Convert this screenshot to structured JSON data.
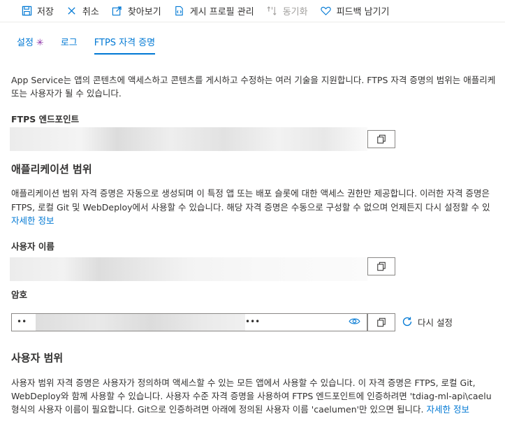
{
  "toolbar": {
    "save": "저장",
    "cancel": "취소",
    "browse": "찾아보기",
    "manage_profile": "게시 프로필 관리",
    "sync": "동기화",
    "feedback": "피드백 남기기"
  },
  "tabs": {
    "settings": "설정",
    "settings_star": "✳",
    "logs": "로그",
    "ftps": "FTPS 자격 증명"
  },
  "intro": {
    "line1": "App Service는 앱의 콘텐츠에 액세스하고 콘텐츠를 게시하고 수정하는 여러 기술을 지원합니다. FTPS 자격 증명의 범위는 애플리케",
    "line2": "또는 사용자가 될 수 있습니다."
  },
  "ftps_endpoint": {
    "label": "FTPS 엔드포인트"
  },
  "app_scope": {
    "title": "애플리케이션 범위",
    "line1": "애플리케이션 범위 자격 증명은 자동으로 생성되며 이 특정 앱 또는 배포 슬롯에 대한 액세스 권한만 제공합니다. 이러한 자격 증명은",
    "line2": "FTPS, 로컬 Git 및 WebDeploy에서 사용할 수 있습니다. 해당 자격 증명은 수동으로 구성할 수 없으며 언제든지 다시 설정할 수 있",
    "link": "자세한 정보"
  },
  "username": {
    "label": "사용자 이름"
  },
  "password": {
    "label": "암호",
    "dots_start": "••",
    "dots_end": "•••",
    "reset": "다시 설정"
  },
  "user_scope": {
    "title": "사용자 범위",
    "line1": "사용자 범위 자격 증명은 사용자가 정의하며 액세스할 수 있는 모든 앱에서 사용할 수 있습니다. 이 자격 증명은 FTPS, 로컬 Git,",
    "line2": "WebDeploy와 함께 사용할 수 있습니다. 사용자 수준 자격 증명을 사용하여 FTPS 엔드포인트에 인증하려면 'tdiag-ml-api\\caelu",
    "line3": "형식의 사용자 이름이 필요합니다. Git으로 인증하려면 아래에 정의된 사용자 이름 'caelumen'만 있으면 됩니다.",
    "link": "자세한 정보"
  }
}
